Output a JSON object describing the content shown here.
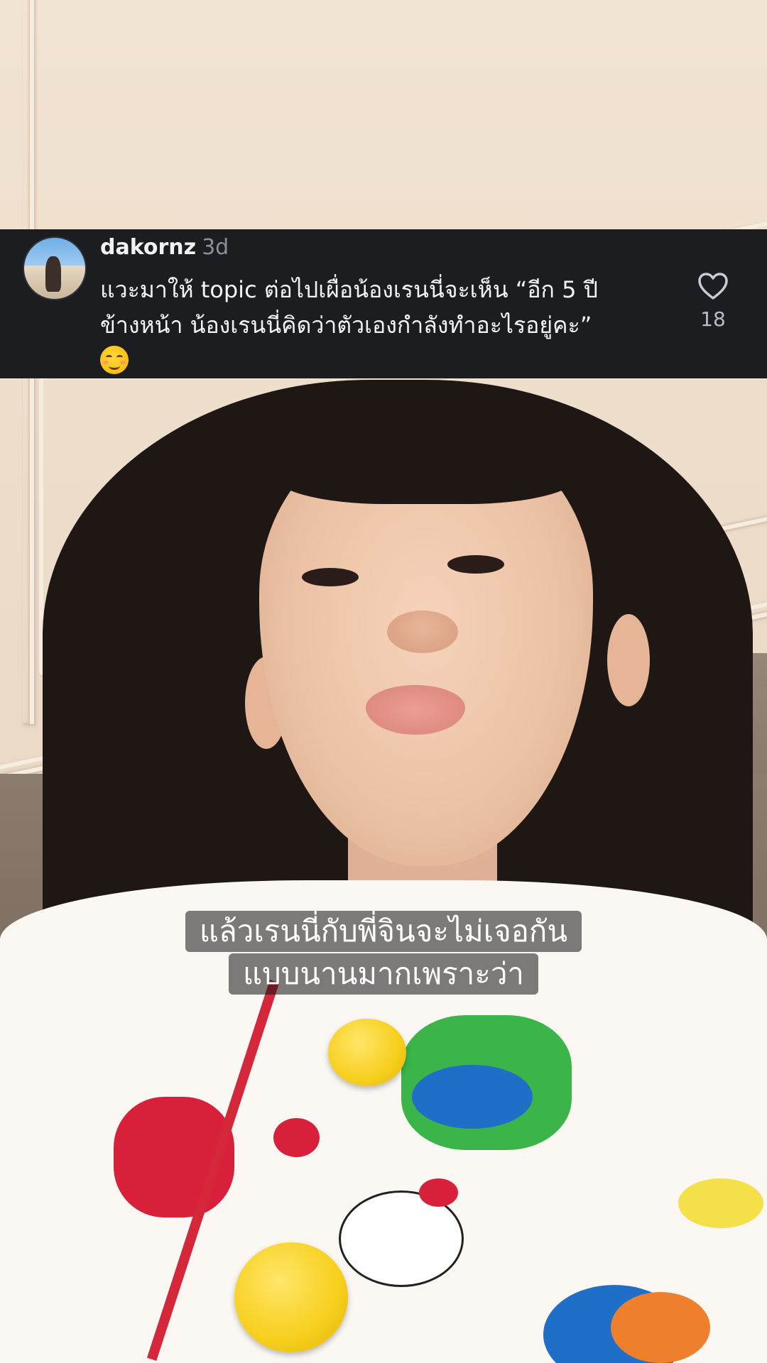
{
  "comment": {
    "username": "dakornz",
    "time": "3d",
    "text_line1": "แวะมาให้ topic ต่อไปเผื่อน้องเรนนี่จะเห็น “อีก 5 ปี",
    "text_line2": "ข้างหน้า น้องเรนนี่คิดว่าตัวเองกำลังทำอะไรอยู่คะ”",
    "emoji_icon": "smiling-face-with-blush-icon",
    "like_icon": "heart-outline-icon",
    "like_count": "18"
  },
  "caption": {
    "line1": "แล้วเรนนี่กับพี่จินจะไม่เจอกัน",
    "line2": "แบบนานมากเพราะว่า"
  },
  "colors": {
    "banner_bg": "#1b1d20",
    "wall": "#ecdcc9",
    "button_yellow": "#f7cf1c",
    "placket_red": "#d4273a"
  }
}
